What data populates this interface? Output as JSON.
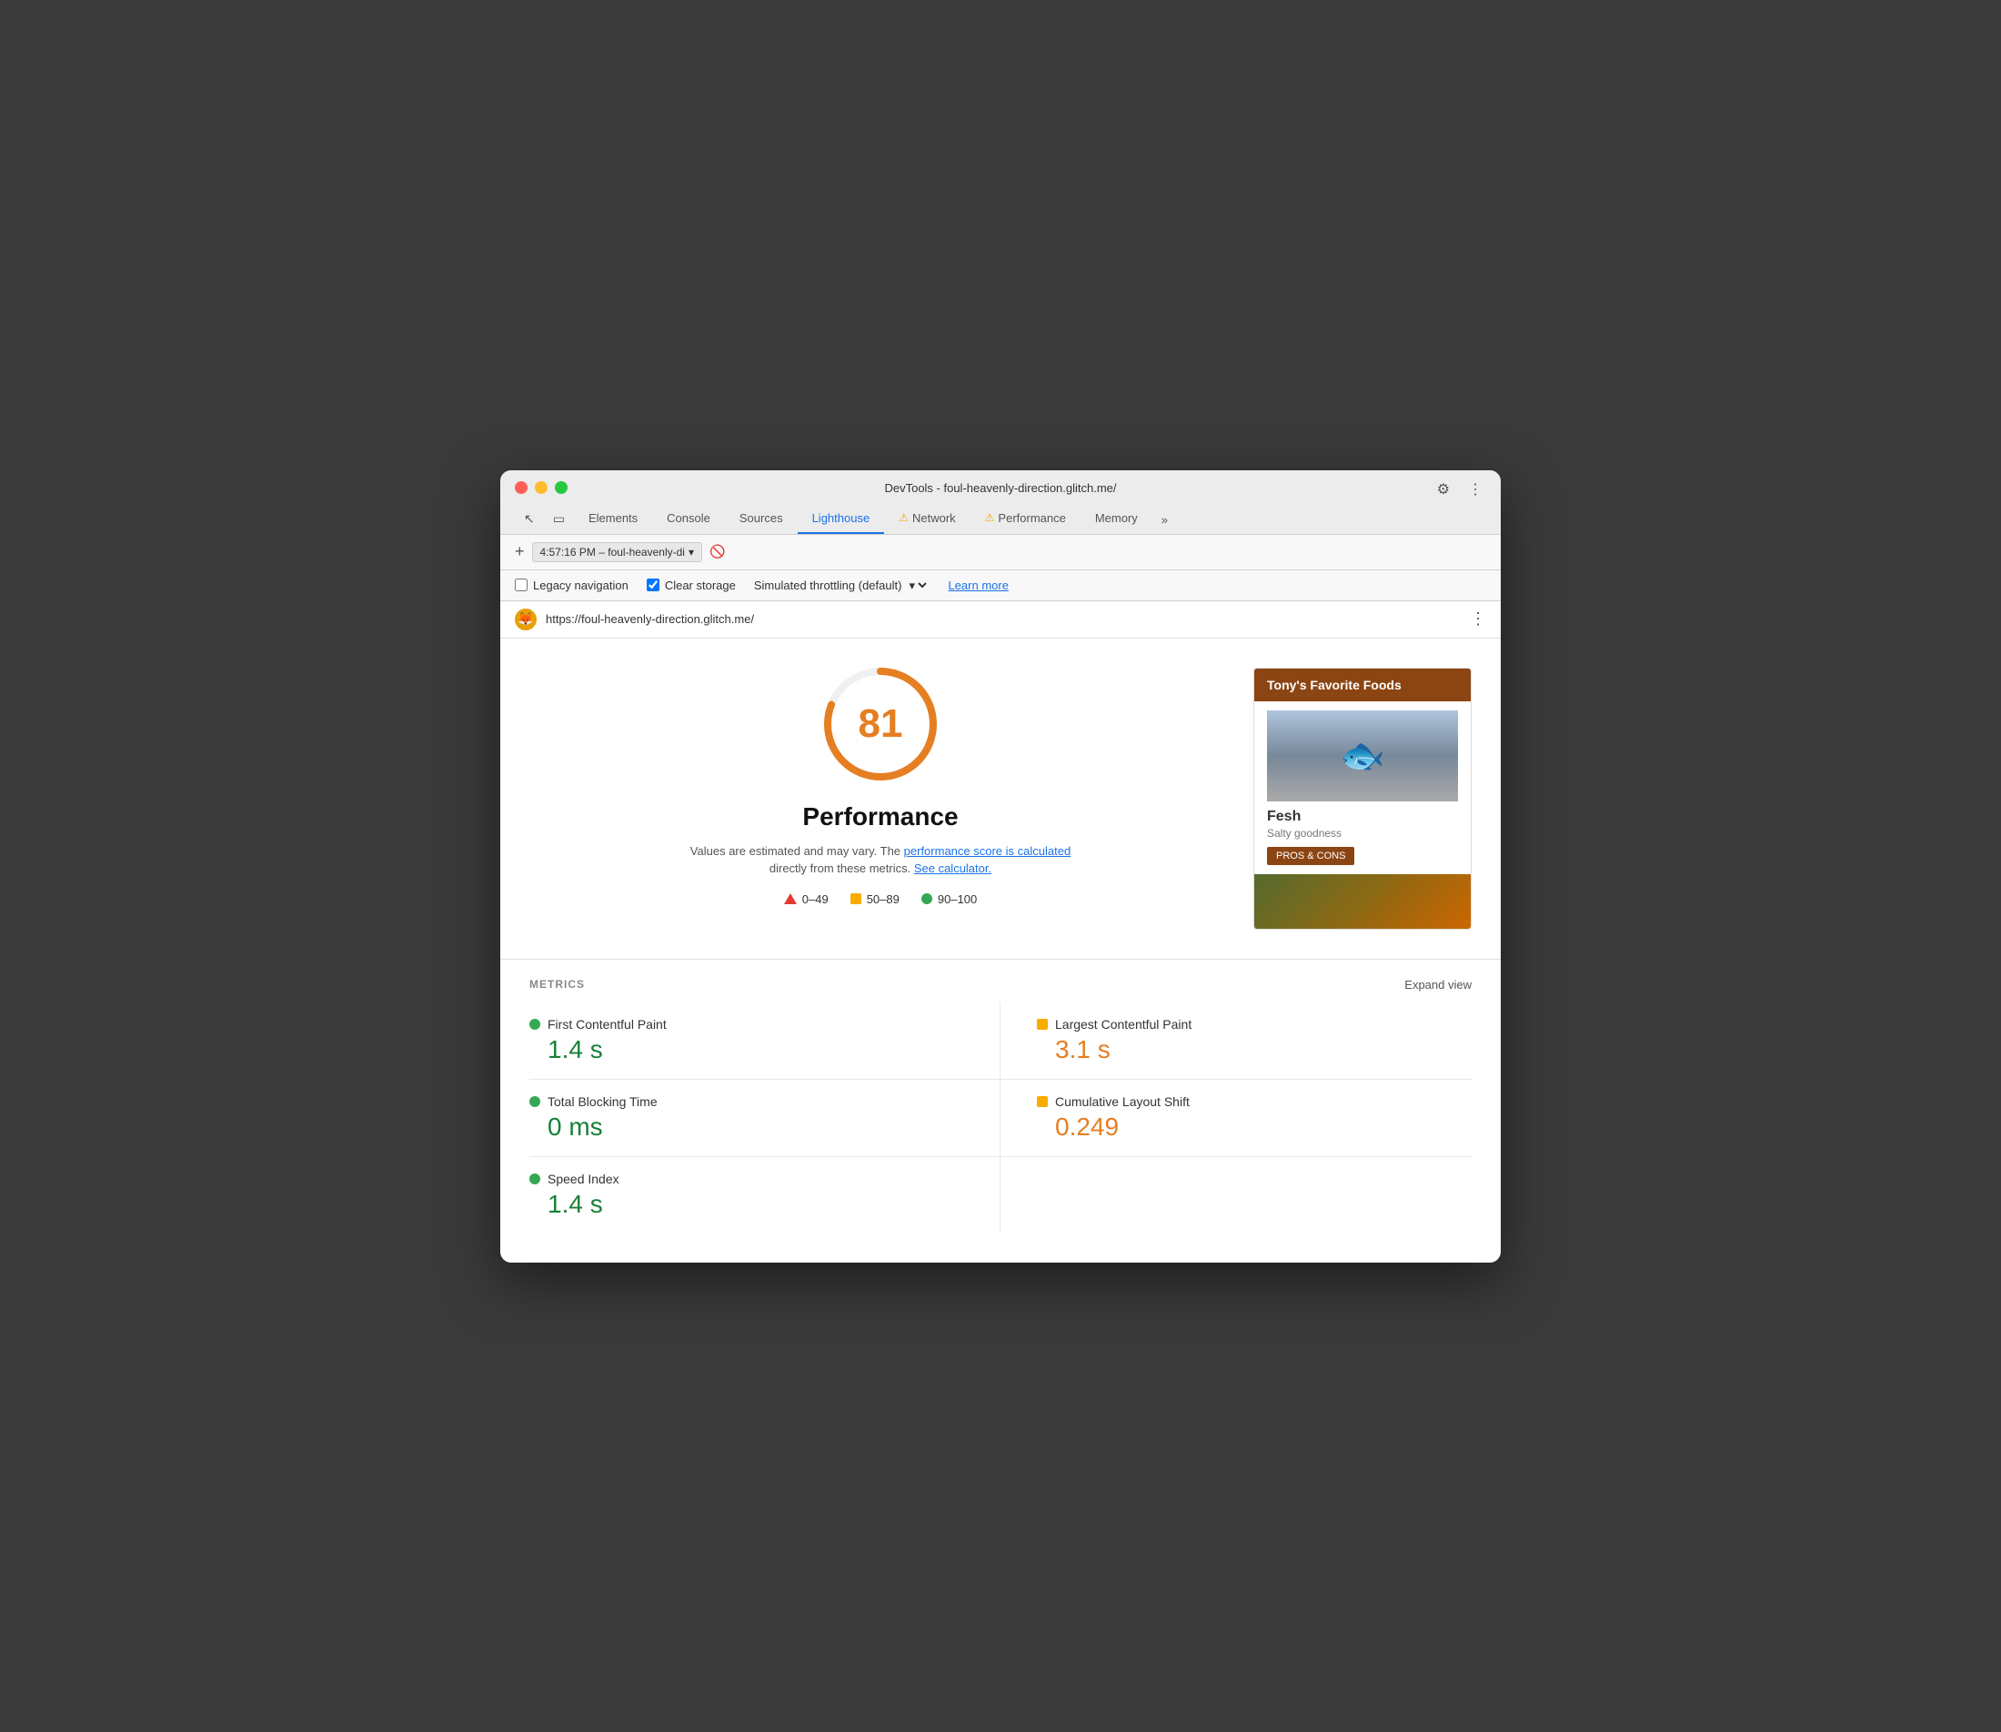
{
  "window": {
    "title": "DevTools - foul-heavenly-direction.glitch.me/"
  },
  "tabs": [
    {
      "id": "elements",
      "label": "Elements",
      "active": false,
      "warning": false
    },
    {
      "id": "console",
      "label": "Console",
      "active": false,
      "warning": false
    },
    {
      "id": "sources",
      "label": "Sources",
      "active": false,
      "warning": false
    },
    {
      "id": "lighthouse",
      "label": "Lighthouse",
      "active": true,
      "warning": false
    },
    {
      "id": "network",
      "label": "Network",
      "active": false,
      "warning": true
    },
    {
      "id": "performance",
      "label": "Performance",
      "active": false,
      "warning": true
    },
    {
      "id": "memory",
      "label": "Memory",
      "active": false,
      "warning": false
    }
  ],
  "address_bar": {
    "timestamp": "4:57:16 PM – foul-heavenly-di",
    "url": "https://foul-heavenly-direction.glitch.me/"
  },
  "options": {
    "legacy_navigation_label": "Legacy navigation",
    "legacy_navigation_checked": false,
    "clear_storage_label": "Clear storage",
    "clear_storage_checked": true,
    "throttling_label": "Simulated throttling (default)",
    "learn_more_label": "Learn more"
  },
  "lighthouse": {
    "score": "81",
    "title": "Performance",
    "description_start": "Values are estimated and may vary. The",
    "description_link1": "performance score is calculated",
    "description_middle": "directly from these metrics.",
    "description_link2": "See calculator.",
    "legend": [
      {
        "id": "low",
        "range": "0–49",
        "type": "red"
      },
      {
        "id": "mid",
        "range": "50–89",
        "type": "orange"
      },
      {
        "id": "high",
        "range": "90–100",
        "type": "green"
      }
    ]
  },
  "preview": {
    "header": "Tony's Favorite Foods",
    "food_name": "Fesh",
    "food_desc": "Salty goodness",
    "pros_cons_btn": "PROS & CONS"
  },
  "metrics": {
    "label": "METRICS",
    "expand_label": "Expand view",
    "items": [
      {
        "id": "fcp",
        "name": "First Contentful Paint",
        "value": "1.4 s",
        "color": "green",
        "dot": "green"
      },
      {
        "id": "lcp",
        "name": "Largest Contentful Paint",
        "value": "3.1 s",
        "color": "orange",
        "dot": "orange"
      },
      {
        "id": "tbt",
        "name": "Total Blocking Time",
        "value": "0 ms",
        "color": "green",
        "dot": "green"
      },
      {
        "id": "cls",
        "name": "Cumulative Layout Shift",
        "value": "0.249",
        "color": "orange",
        "dot": "orange"
      },
      {
        "id": "si",
        "name": "Speed Index",
        "value": "1.4 s",
        "color": "green",
        "dot": "green"
      }
    ]
  }
}
